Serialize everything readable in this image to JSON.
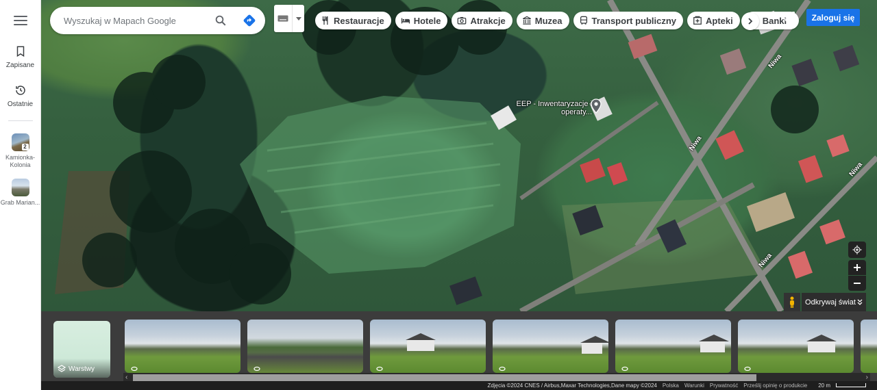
{
  "sidebar": {
    "saved_label": "Zapisane",
    "recent_label": "Ostatnie",
    "recents": [
      {
        "label": "Kamionka-Kolonia",
        "badge": "2"
      },
      {
        "label": "Grab Marian..."
      }
    ]
  },
  "search": {
    "placeholder": "Wyszukaj w Mapach Google"
  },
  "categories": [
    {
      "label": "Restauracje",
      "icon": "cutlery-icon"
    },
    {
      "label": "Hotele",
      "icon": "bed-icon"
    },
    {
      "label": "Atrakcje",
      "icon": "camera-icon"
    },
    {
      "label": "Muzea",
      "icon": "museum-icon"
    },
    {
      "label": "Transport publiczny",
      "icon": "bus-icon"
    },
    {
      "label": "Apteki",
      "icon": "pharmacy-icon"
    },
    {
      "label": "Banki",
      "icon": "atm-icon"
    }
  ],
  "header": {
    "signin_label": "Zaloguj się"
  },
  "map": {
    "place_label": "EEP - Inwentaryzacje i operaty...",
    "street_labels": [
      "Niwa",
      "Niwa",
      "Niwa",
      "Niwa"
    ]
  },
  "controls": {
    "explore_label": "Odkrywaj świat"
  },
  "strip": {
    "layers_label": "Warstwy"
  },
  "footer": {
    "attribution": "Zdjęcia ©2024 CNES / Airbus,Maxar Technologies,Dane mapy ©2024",
    "links": [
      "Polska",
      "Warunki",
      "Prywatność",
      "Prześlij opinię o produkcie"
    ],
    "scale_label": "20 m"
  },
  "colors": {
    "accent": "#1a73e8",
    "directions": "#1a73e8"
  }
}
